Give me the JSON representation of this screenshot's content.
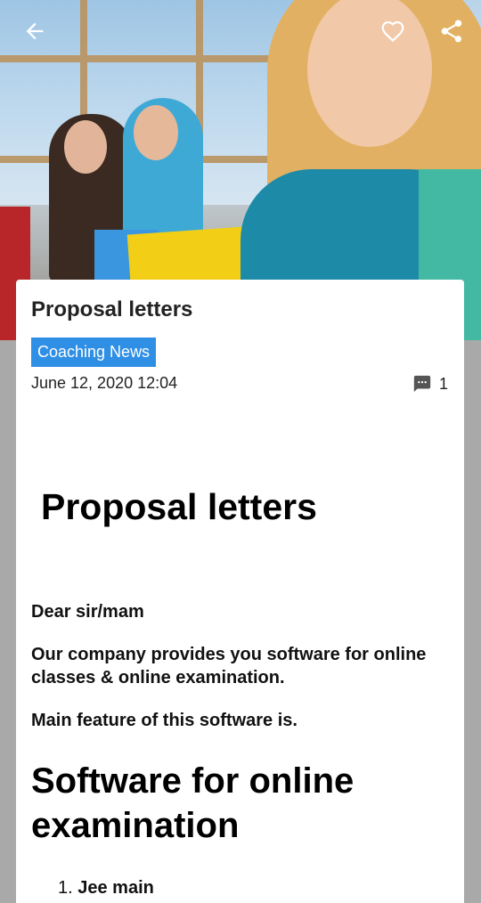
{
  "header": {
    "back_icon": "arrow-left-icon",
    "favorite_icon": "heart-outline-icon",
    "share_icon": "share-icon"
  },
  "article": {
    "title": "Proposal letters",
    "category": "Coaching News",
    "datetime": "June 12, 2020 12:04",
    "comment_count": "1",
    "comment_icon": "comment-icon"
  },
  "content": {
    "heading": "Proposal letters",
    "greeting": "Dear sir/mam",
    "intro": "Our company provides you software for online classes & online examination.",
    "feature_intro": "Main feature of this software is.",
    "section_heading": "Software for online examination",
    "list": [
      {
        "number": "1.",
        "text": "Jee main"
      }
    ]
  },
  "colors": {
    "badge": "#2f8fe5",
    "page_background": "#a9a9a9"
  }
}
